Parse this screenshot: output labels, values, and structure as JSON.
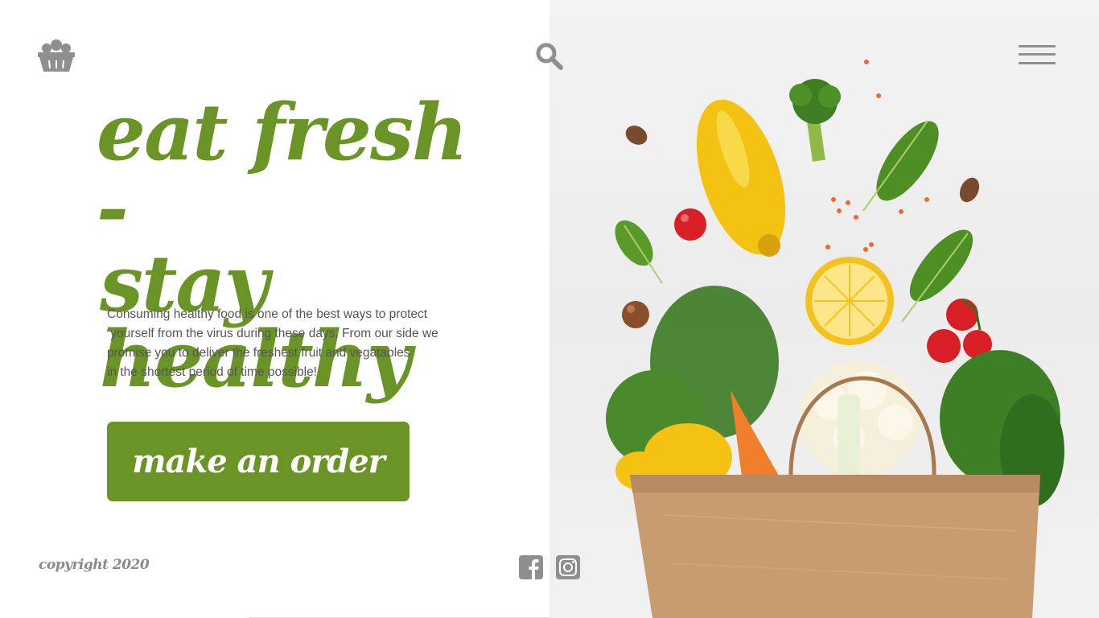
{
  "header": {
    "logo_icon": "basket-icon",
    "search_icon": "search-icon",
    "menu_icon": "hamburger-menu-icon"
  },
  "hero": {
    "headline_line1": "eat fresh -",
    "headline_line2": "stay healthy",
    "paragraph_lines": [
      "Consuming healthy food is one of the best ways to protect",
      " yourself from the virus during these days. From our side we",
      "promise you to deliver the freshest fruit and vegatables",
      "in the shortest period of time possible!"
    ],
    "cta_label": "make an order"
  },
  "footer": {
    "copyright": "copyright 2020",
    "social": [
      "facebook-icon",
      "instagram-icon"
    ]
  },
  "colors": {
    "brand_green": "#6a9426",
    "icon_gray": "#8f8f8f",
    "text_gray": "#555555",
    "background": "#ffffff"
  }
}
